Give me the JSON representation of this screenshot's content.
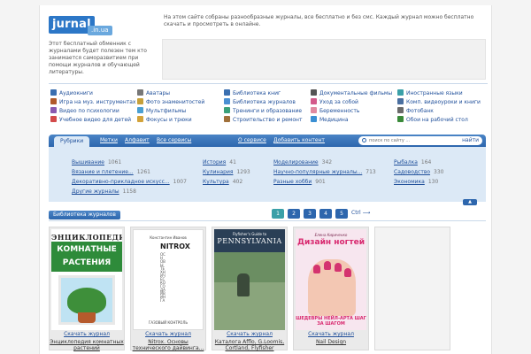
{
  "header": {
    "logo_main": "jurnal",
    "logo_sub": ".in.ua",
    "about": "Этот бесплатный обменник с журналами будет полезен тем кто занимается саморазвитием при помощи журналов и обучающей литературы.",
    "intro": "На этом сайте собраны разнообразные журналы, все бесплатно и без смс. Каждый журнал можно бесплатно скачать и просмотреть в онлайне."
  },
  "categories": [
    {
      "label": "Аудиокниги",
      "icon": "headphones-icon",
      "color": "#3a6fb0"
    },
    {
      "label": "Игра на муз. инструментах",
      "icon": "guitar-icon",
      "color": "#b05a2a"
    },
    {
      "label": "Видео по психологии",
      "icon": "brain-icon",
      "color": "#8a5ab0"
    },
    {
      "label": "Учебное видео для детей",
      "icon": "kids-icon",
      "color": "#d34a4a"
    },
    {
      "label": "Аватары",
      "icon": "avatar-icon",
      "color": "#777777"
    },
    {
      "label": "Фото знаменитостей",
      "icon": "photo-icon",
      "color": "#c6a03a"
    },
    {
      "label": "Мультфильмы",
      "icon": "cartoon-icon",
      "color": "#4aa0d3"
    },
    {
      "label": "Фокусы и трюки",
      "icon": "magic-icon",
      "color": "#d3a33a"
    },
    {
      "label": "Библиотека книг",
      "icon": "books-icon",
      "color": "#3a6fb0"
    },
    {
      "label": "Библиотека журналов",
      "icon": "magazine-icon",
      "color": "#4a8fd3"
    },
    {
      "label": "Тренинги и образование",
      "icon": "training-icon",
      "color": "#3aa07a"
    },
    {
      "label": "Строительство и ремонт",
      "icon": "hammer-icon",
      "color": "#a0703a"
    },
    {
      "label": "Документальные фильмы",
      "icon": "film-icon",
      "color": "#555555"
    },
    {
      "label": "Уход за собой",
      "icon": "care-icon",
      "color": "#d35a8a"
    },
    {
      "label": "Беременность",
      "icon": "baby-icon",
      "color": "#e08aa0"
    },
    {
      "label": "Медицина",
      "icon": "medicine-icon",
      "color": "#3a8fd3"
    },
    {
      "label": "Иностранные языки",
      "icon": "globe-icon",
      "color": "#3aa0a8"
    },
    {
      "label": "Комп. видеоуроки и книги",
      "icon": "computer-icon",
      "color": "#4a6fa0"
    },
    {
      "label": "Фотобанк",
      "icon": "camera-icon",
      "color": "#6a6a6a"
    },
    {
      "label": "Обои на рабочий стол",
      "icon": "wallpaper-icon",
      "color": "#3a8a3a"
    }
  ],
  "nav": {
    "active_tab": "Рубрики",
    "items": [
      "Метки",
      "Алфавит",
      "Все сервисы"
    ],
    "links": [
      "О сервисе",
      "Добавить контент"
    ],
    "search_placeholder": "поиск по сайту ...",
    "search_button": "найти"
  },
  "rubrics": [
    {
      "label": "Вышивание",
      "count": "1061"
    },
    {
      "label": "Вязание и плетение...",
      "count": "1261"
    },
    {
      "label": "Декоративно-прикладное искусс...",
      "count": "1007"
    },
    {
      "label": "Другие журналы",
      "count": "1158"
    },
    {
      "label": "История",
      "count": "41"
    },
    {
      "label": "Кулинария",
      "count": "1293"
    },
    {
      "label": "Культура",
      "count": "402"
    },
    {
      "label": "Моделирование",
      "count": "342"
    },
    {
      "label": "Научно-популярные журналы...",
      "count": "713"
    },
    {
      "label": "Разные хобби",
      "count": "901"
    },
    {
      "label": "Рыбалка",
      "count": "164"
    },
    {
      "label": "Садоводство",
      "count": "330"
    },
    {
      "label": "Экономика",
      "count": "130"
    }
  ],
  "library": {
    "button": "Библиотека журналов",
    "pages": [
      "1",
      "2",
      "3",
      "4",
      "5"
    ],
    "ctrl": "Ctrl"
  },
  "books": [
    {
      "download": "Скачать журнал",
      "title": "Энциклопедия комнатных растений",
      "cover_top": "ЭНЦИКЛОПЕДИЯ",
      "cover_main": "КОМНАТНЫЕ РАСТЕНИЯ"
    },
    {
      "download": "Скачать журнал",
      "title": "Nitrox. Основы технического дайвинга...",
      "cover_author": "Константин Иванов",
      "cover_title": "NITROX",
      "cover_sub": "ОСНОВЫ ТЕХНИЧЕСКОГО ДАЙВИНГА",
      "cover_pub": "ГАЗОВЫЙ КОНТРОЛЬ"
    },
    {
      "download": "Скачать журнал",
      "title": "Каталога Afflo, G.Loomis, Cortland, Flyfisher",
      "cover_top": "Flyfisher's Guide to",
      "cover_main": "PENNSYLVANIA"
    },
    {
      "download": "Скачать журнал",
      "title": "Nail Design",
      "cover_author": "Елена Кириченко",
      "cover_main": "Дизайн ногтей",
      "cover_bottom": "ШЕДЕВРЫ НЕЙЛ-АРТА ШАГ ЗА ШАГОМ"
    }
  ]
}
